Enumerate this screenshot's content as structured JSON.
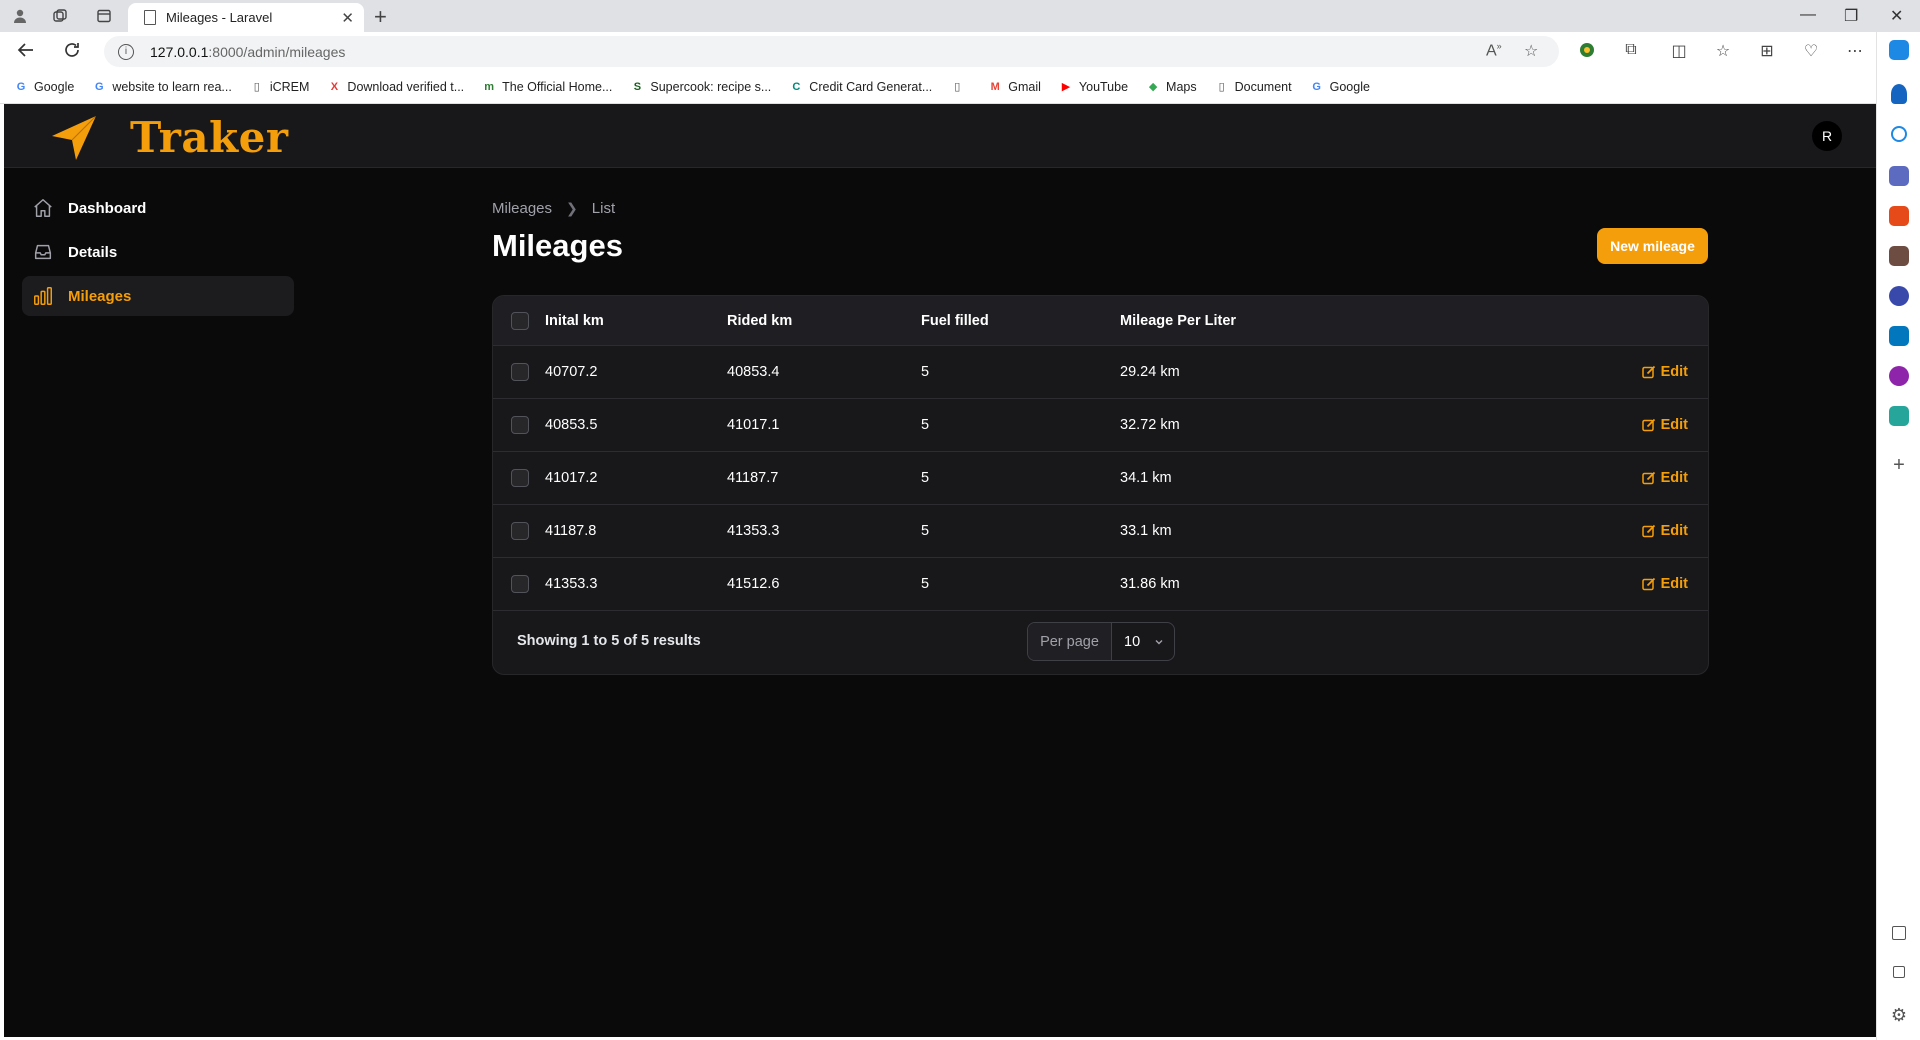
{
  "browser": {
    "tab_title": "Mileages - Laravel",
    "url_host": "127.0.0.1",
    "url_path": ":8000/admin/mileages",
    "bookmarks": [
      {
        "label": "Google",
        "icon": "G",
        "color": "#4285f4"
      },
      {
        "label": "website to learn rea...",
        "icon": "G",
        "color": "#4285f4"
      },
      {
        "label": "iCREM",
        "icon": "▯",
        "color": "#555555"
      },
      {
        "label": "Download verified t...",
        "icon": "X",
        "color": "#e53935"
      },
      {
        "label": "The Official Home...",
        "icon": "m",
        "color": "#2e7d32"
      },
      {
        "label": "Supercook: recipe s...",
        "icon": "S",
        "color": "#1b5e20"
      },
      {
        "label": "Credit Card Generat...",
        "icon": "C",
        "color": "#00897b"
      },
      {
        "label": "",
        "icon": "▯",
        "color": "#555555"
      },
      {
        "label": "Gmail",
        "icon": "M",
        "color": "#ea4335"
      },
      {
        "label": "YouTube",
        "icon": "▶",
        "color": "#ff0000"
      },
      {
        "label": "Maps",
        "icon": "◆",
        "color": "#34a853"
      },
      {
        "label": "Document",
        "icon": "▯",
        "color": "#555555"
      },
      {
        "label": "Google",
        "icon": "G",
        "color": "#4285f4"
      }
    ]
  },
  "app": {
    "brand": "Traker",
    "avatar_initial": "R",
    "accent_color": "#f59e0b",
    "sidebar": [
      {
        "label": "Dashboard",
        "icon": "home-icon",
        "active": false
      },
      {
        "label": "Details",
        "icon": "inbox-icon",
        "active": false
      },
      {
        "label": "Mileages",
        "icon": "chart-bar-icon",
        "active": true
      }
    ],
    "breadcrumb": {
      "first": "Mileages",
      "second": "List"
    },
    "page_title": "Mileages",
    "new_button": "New mileage",
    "table": {
      "headers": [
        "Inital km",
        "Rided km",
        "Fuel filled",
        "Mileage Per Liter"
      ],
      "rows": [
        [
          "40707.2",
          "40853.4",
          "5",
          "29.24 km"
        ],
        [
          "40853.5",
          "41017.1",
          "5",
          "32.72 km"
        ],
        [
          "41017.2",
          "41187.7",
          "5",
          "34.1 km"
        ],
        [
          "41187.8",
          "41353.3",
          "5",
          "33.1 km"
        ],
        [
          "41353.3",
          "41512.6",
          "5",
          "31.86 km"
        ]
      ],
      "edit_label": "Edit",
      "showing": "Showing 1 to 5 of 5 results",
      "per_page_label": "Per page",
      "per_page_value": "10"
    }
  }
}
